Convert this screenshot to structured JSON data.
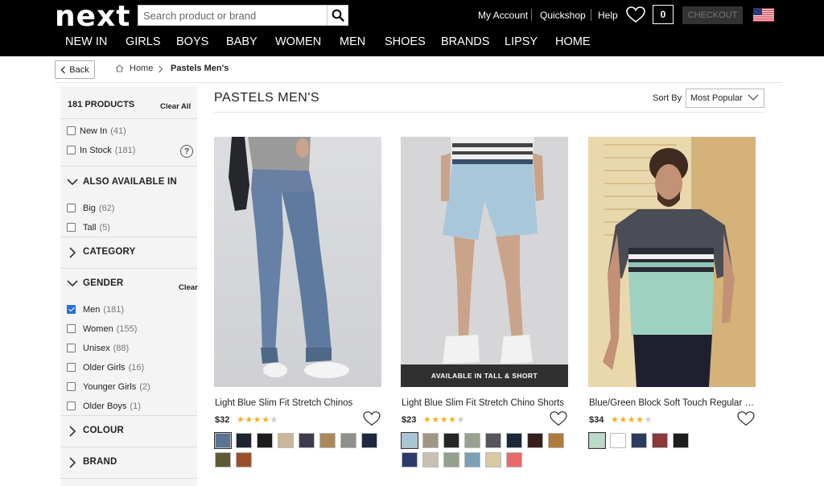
{
  "header": {
    "logo": "next",
    "search_placeholder": "Search product or brand",
    "links": [
      "My Account",
      "Quickshop",
      "Help"
    ],
    "bag_count": "0",
    "checkout_label": "CHECKOUT",
    "nav": [
      "NEW IN",
      "GIRLS",
      "BOYS",
      "BABY",
      "WOMEN",
      "MEN",
      "SHOES",
      "BRANDS",
      "LIPSY",
      "HOME"
    ]
  },
  "breadcrumb": {
    "back_label": "Back",
    "home": "Home",
    "current": "Pastels Men's"
  },
  "sidebar": {
    "count": "181 PRODUCTS",
    "clear_all": "Clear All",
    "top_options": [
      {
        "label": "New In",
        "count": "(41)"
      },
      {
        "label": "In Stock",
        "count": "(181)"
      }
    ],
    "help_label": "?",
    "sections": {
      "also_available": {
        "title": "ALSO AVAILABLE IN",
        "options": [
          {
            "label": "Big",
            "count": "(62)"
          },
          {
            "label": "Tall",
            "count": "(5)"
          }
        ]
      },
      "category": {
        "title": "CATEGORY"
      },
      "gender": {
        "title": "GENDER",
        "clear": "Clear",
        "options": [
          {
            "label": "Men",
            "count": "(181)",
            "checked": true
          },
          {
            "label": "Women",
            "count": "(155)"
          },
          {
            "label": "Unisex",
            "count": "(88)"
          },
          {
            "label": "Older Girls",
            "count": "(16)"
          },
          {
            "label": "Younger Girls",
            "count": "(2)"
          },
          {
            "label": "Older Boys",
            "count": "(1)"
          }
        ]
      },
      "colour": {
        "title": "COLOUR"
      },
      "brand": {
        "title": "BRAND"
      }
    }
  },
  "main": {
    "title": "PASTELS MEN'S",
    "sort_label": "Sort By",
    "sort_value": "Most Popular"
  },
  "products": [
    {
      "name": "Light Blue Slim Fit Stretch Chinos",
      "price": "$32",
      "rating": 4.5,
      "swatches": [
        "#5a7594",
        "#1e2430",
        "#1c1c1c",
        "#c8b898",
        "#3c3c4c",
        "#a88a5a",
        "#8e8e8a",
        "#1f2840",
        "#5e5a34",
        "#9a5028"
      ]
    },
    {
      "name": "Light Blue Slim Fit Stretch Chino Shorts",
      "price": "$23",
      "rating": 4.5,
      "badge": "AVAILABLE IN TALL & SHORT",
      "swatches": [
        "#a8c6d6",
        "#a09684",
        "#262626",
        "#9aa08e",
        "#56565a",
        "#1e2838",
        "#3a1e1e",
        "#b07a3c",
        "#2c3a6e",
        "#c8c0b0",
        "#96a08e",
        "#7aa0b4",
        "#d8c8a4",
        "#e86a6a"
      ]
    },
    {
      "name": "Blue/Green Block Soft Touch Regular Fit Crew T-Shirt",
      "price": "$34",
      "rating": 4.5,
      "swatches": [
        "#b8dcc8",
        "#ffffff",
        "#2c3a5e",
        "#8a3a3a",
        "#1e1e1e"
      ]
    }
  ],
  "colors": {
    "header_bg": "#000000",
    "accent_check": "#2a6fd6",
    "star": "#f2b01e"
  }
}
